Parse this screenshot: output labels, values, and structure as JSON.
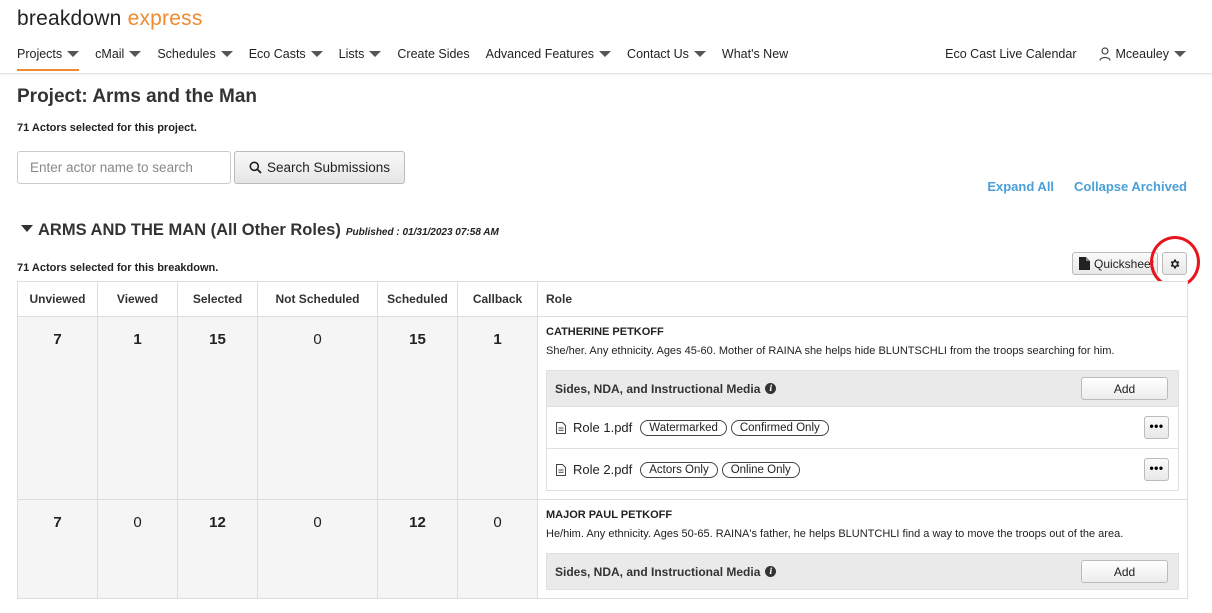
{
  "logo": {
    "part1": "breakdown",
    "part2": "express"
  },
  "nav": {
    "items": [
      {
        "label": "Projects",
        "caret": true,
        "active": true
      },
      {
        "label": "cMail",
        "caret": true
      },
      {
        "label": "Schedules",
        "caret": true
      },
      {
        "label": "Eco Casts",
        "caret": true
      },
      {
        "label": "Lists",
        "caret": true
      },
      {
        "label": "Create Sides",
        "caret": false
      },
      {
        "label": "Advanced Features",
        "caret": true
      },
      {
        "label": "Contact Us",
        "caret": true
      },
      {
        "label": "What's New",
        "caret": false
      }
    ],
    "right": {
      "calendar": "Eco Cast Live Calendar",
      "user": "Mceauley"
    }
  },
  "project": {
    "title": "Project: Arms and the Man",
    "actors_selected": "71 Actors selected for this project."
  },
  "search": {
    "placeholder": "Enter actor name to search",
    "button": "Search Submissions"
  },
  "links": {
    "expand": "Expand All",
    "collapse": "Collapse Archived"
  },
  "breakdown": {
    "name": "ARMS AND THE MAN (All Other Roles)",
    "published": "Published : 01/31/2023 07:58 AM",
    "actors_selected": "71 Actors selected for this breakdown.",
    "quicksheet": "Quicksheet"
  },
  "table": {
    "headers": {
      "unviewed": "Unviewed",
      "viewed": "Viewed",
      "selected": "Selected",
      "not_scheduled": "Not Scheduled",
      "scheduled": "Scheduled",
      "callback": "Callback",
      "role": "Role"
    },
    "rows": [
      {
        "unviewed": "7",
        "viewed": "1",
        "selected": "15",
        "not_scheduled": "0",
        "scheduled": "15",
        "callback": "1",
        "role_name": "CATHERINE PETKOFF",
        "role_desc": "She/her. Any ethnicity. Ages 45-60. Mother of RAINA she helps hide BLUNTSCHLI from the troops searching for him.",
        "sides_label": "Sides, NDA, and Instructional Media",
        "add": "Add",
        "files": [
          {
            "name": "Role 1.pdf",
            "tag1": "Watermarked",
            "tag2": "Confirmed Only",
            "more": "•••"
          },
          {
            "name": "Role 2.pdf",
            "tag1": "Actors Only",
            "tag2": "Online Only",
            "more": "•••"
          }
        ]
      },
      {
        "unviewed": "7",
        "viewed": "0",
        "selected": "12",
        "not_scheduled": "0",
        "scheduled": "12",
        "callback": "0",
        "role_name": "MAJOR PAUL PETKOFF",
        "role_desc": "He/him. Any ethnicity. Ages 50-65. RAINA's father, he helps BLUNTCHLI find a way to move the troops out of the area.",
        "sides_label": "Sides, NDA, and Instructional Media",
        "add": "Add"
      }
    ]
  }
}
